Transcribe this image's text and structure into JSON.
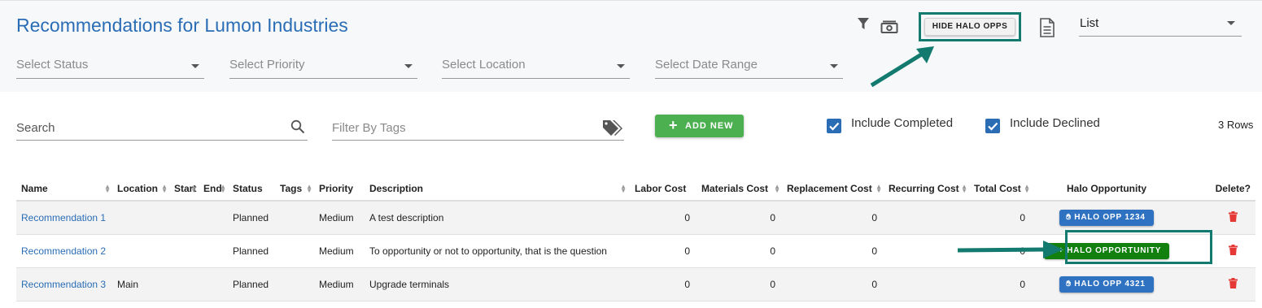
{
  "header": {
    "title": "Recommendations for Lumon Industries",
    "hide_halo_label": "HIDE HALO OPPS",
    "view_select": {
      "value": "List"
    }
  },
  "filters": {
    "status_placeholder": "Select Status",
    "priority_placeholder": "Select Priority",
    "location_placeholder": "Select Location",
    "date_range_placeholder": "Select Date Range"
  },
  "toolbar": {
    "search_placeholder": "Search",
    "tags_placeholder": "Filter By Tags",
    "add_new_label": "ADD NEW",
    "include_completed_label": "Include Completed",
    "include_declined_label": "Include Declined",
    "include_completed_checked": true,
    "include_declined_checked": true,
    "rows_count": "3 Rows"
  },
  "table": {
    "columns": [
      "Name",
      "Location",
      "Start",
      "End",
      "Status",
      "Tags",
      "Priority",
      "Description",
      "Labor Cost",
      "Materials Cost",
      "Replacement Cost",
      "Recurring Cost",
      "Total Cost",
      "Halo Opportunity",
      "Delete?"
    ],
    "rows": [
      {
        "name": "Recommendation 1",
        "location": "",
        "start": "",
        "end": "",
        "status": "Planned",
        "tags": "",
        "priority": "Medium",
        "description": "A test description",
        "labor": "0",
        "materials": "0",
        "replacement": "0",
        "recurring": "",
        "total": "0",
        "halo": "HALO OPP 1234",
        "halo_type": "existing"
      },
      {
        "name": "Recommendation 2",
        "location": "",
        "start": "",
        "end": "",
        "status": "Planned",
        "tags": "",
        "priority": "Medium",
        "description": "To opportunity or not to opportunity, that is the question",
        "labor": "0",
        "materials": "0",
        "replacement": "0",
        "recurring": "",
        "total": "0",
        "halo": "+ HALO OPPORTUNITY",
        "halo_type": "new"
      },
      {
        "name": "Recommendation 3",
        "location": "Main",
        "start": "",
        "end": "",
        "status": "Planned",
        "tags": "",
        "priority": "Medium",
        "description": "Upgrade terminals",
        "labor": "0",
        "materials": "0",
        "replacement": "0",
        "recurring": "",
        "total": "0",
        "halo": "HALO OPP 4321",
        "halo_type": "existing"
      }
    ]
  },
  "colors": {
    "accent": "#2a6db5",
    "add_button": "#4caf50",
    "halo_existing": "#2f72c2",
    "halo_new": "#11800f",
    "delete": "#e53935",
    "annotation": "#127a6e"
  }
}
